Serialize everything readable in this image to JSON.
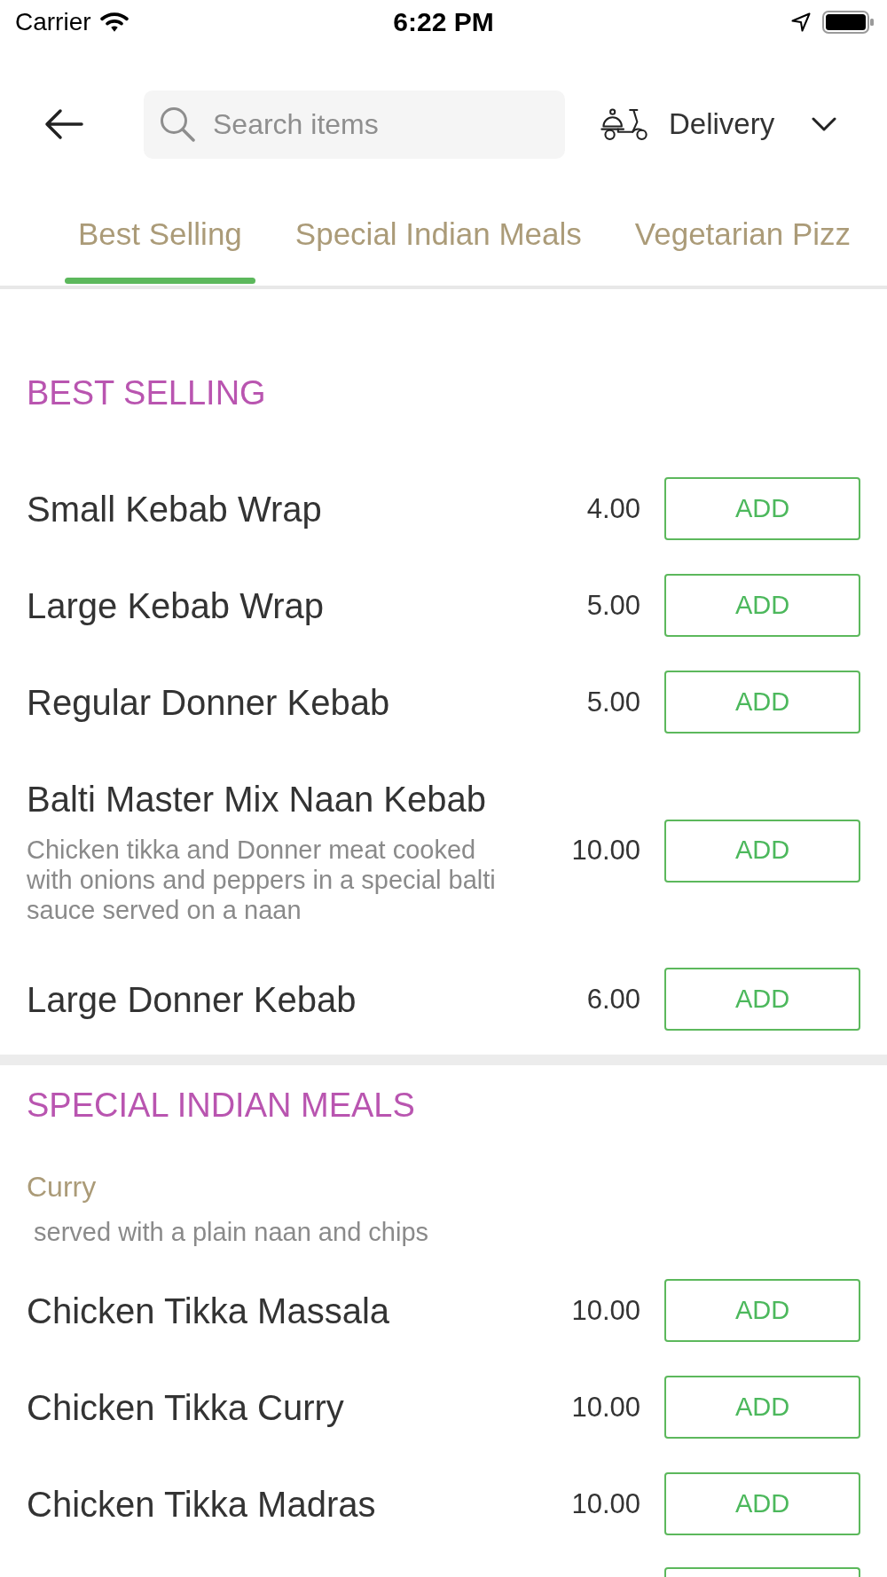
{
  "status_bar": {
    "carrier": "Carrier",
    "time": "6:22 PM"
  },
  "header": {
    "search": {
      "placeholder": "Search items"
    },
    "order_type": "Delivery"
  },
  "tabs": [
    {
      "label": "Best Selling",
      "selected": true
    },
    {
      "label": "Special Indian Meals",
      "selected": false
    },
    {
      "label": "Vegetarian Pizz",
      "selected": false
    }
  ],
  "sections": [
    {
      "title": "BEST SELLING",
      "groups": [
        {
          "items": [
            {
              "name": "Small Kebab Wrap",
              "price": "4.00",
              "button": "ADD"
            },
            {
              "name": "Large Kebab Wrap",
              "price": "5.00",
              "button": "ADD"
            },
            {
              "name": "Regular Donner Kebab",
              "price": "5.00",
              "button": "ADD"
            },
            {
              "name": "Balti Master Mix Naan Kebab",
              "description": "Chicken tikka and Donner meat cooked with onions and peppers in a special balti sauce served on a naan",
              "price": "10.00",
              "button": "ADD"
            },
            {
              "name": "Large Donner Kebab",
              "price": "6.00",
              "button": "ADD"
            }
          ]
        }
      ]
    },
    {
      "title": "SPECIAL INDIAN MEALS",
      "groups": [
        {
          "name": "Curry",
          "note": " served with a plain naan and chips",
          "items": [
            {
              "name": "Chicken Tikka Massala",
              "price": "10.00",
              "button": "ADD"
            },
            {
              "name": "Chicken Tikka Curry",
              "price": "10.00",
              "button": "ADD"
            },
            {
              "name": "Chicken Tikka Madras",
              "price": "10.00",
              "button": "ADD"
            }
          ]
        }
      ]
    }
  ]
}
